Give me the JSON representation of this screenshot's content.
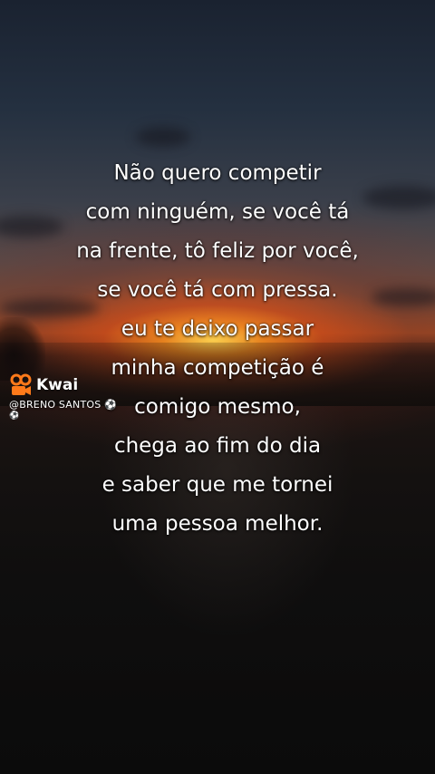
{
  "quote": {
    "lines": [
      "Não quero competir",
      "com ninguém, se você tá",
      "na frente, tô feliz por você,",
      "se você tá com pressa.",
      "eu te deixo passar",
      "minha competição é",
      "comigo mesmo,",
      "chega ao fim do dia",
      "e saber que me tornei",
      "uma pessoa melhor."
    ]
  },
  "watermark": {
    "brand": "Kwai",
    "handle": "@BRENO SANTOS",
    "logo_icon": "kwai-camera-logo",
    "handle_icon": "soccer-ball-icon",
    "brand_color": "#ff7a1a"
  }
}
